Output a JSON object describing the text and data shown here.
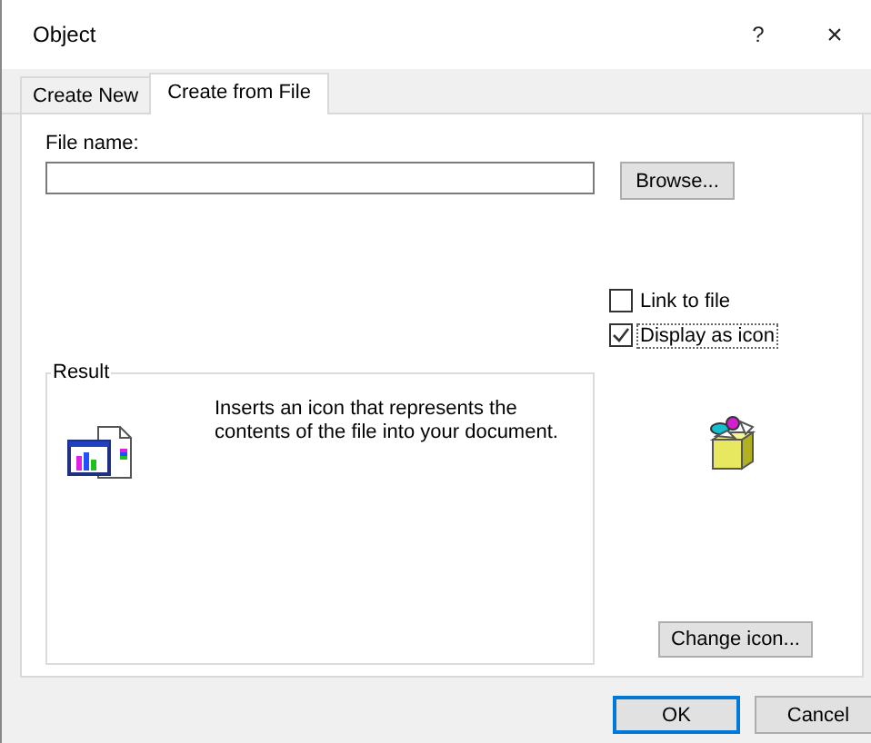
{
  "window": {
    "title": "Object",
    "help": "?",
    "close": "×"
  },
  "tabs": [
    {
      "label": "Create New",
      "selected": false
    },
    {
      "label": "Create from File",
      "selected": true
    }
  ],
  "file_name": {
    "label": "File name:"
  },
  "browse_button": "Browse...",
  "options": [
    {
      "label": "Link to file",
      "checked": false,
      "focused": false
    },
    {
      "label": "Display as icon",
      "checked": true,
      "focused": true
    }
  ],
  "result": {
    "title": "Result",
    "text": "Inserts an icon that represents the contents of the file into your document."
  },
  "change_icon_button": "Change icon...",
  "buttons": [
    {
      "label": "OK",
      "default": true
    },
    {
      "label": "Cancel",
      "default": false
    }
  ]
}
